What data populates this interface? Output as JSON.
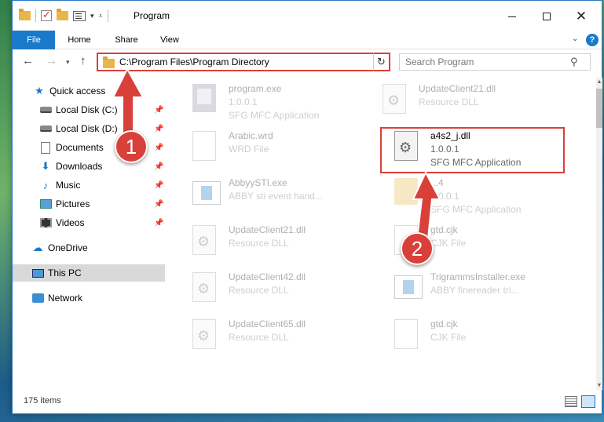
{
  "window": {
    "title": "Program"
  },
  "ribbon": {
    "tabs": [
      {
        "label": "File"
      },
      {
        "label": "Home"
      },
      {
        "label": "Share"
      },
      {
        "label": "View"
      }
    ]
  },
  "nav": {
    "address_path": "C:\\Program Files\\Program Directory",
    "search_placeholder": "Search Program"
  },
  "sidebar": {
    "items": [
      {
        "label": "Quick access"
      },
      {
        "label": "Local Disk (C:)"
      },
      {
        "label": "Local Disk (D:)"
      },
      {
        "label": "Documents"
      },
      {
        "label": "Downloads"
      },
      {
        "label": "Music"
      },
      {
        "label": "Pictures"
      },
      {
        "label": "Videos"
      },
      {
        "label": "OneDrive"
      },
      {
        "label": "This PC"
      },
      {
        "label": "Network"
      }
    ]
  },
  "files": [
    {
      "name": "program.exe",
      "line2": "1.0.0.1",
      "line3": "SFG MFC Application"
    },
    {
      "name": "UpdateClient21.dll",
      "line2": "Resource DLL",
      "line3": ""
    },
    {
      "name": "Arabic.wrd",
      "line2": "WRD File",
      "line3": ""
    },
    {
      "name": "a4s2_j.dll",
      "line2": "1.0.0.1",
      "line3": "SFG MFC Application"
    },
    {
      "name": "AbbyySTI.exe",
      "line2": "ABBY sti event hand...",
      "line3": ""
    },
    {
      "name": "...4",
      "line2": "1.0.0.1",
      "line3": "SFG MFC Application"
    },
    {
      "name": "UpdateClient21.dll",
      "line2": "Resource DLL",
      "line3": ""
    },
    {
      "name": "gtd.cjk",
      "line2": "CJK File",
      "line3": ""
    },
    {
      "name": "UpdateClient42.dll",
      "line2": "Resource DLL",
      "line3": ""
    },
    {
      "name": "TrigrammsInstaller.exe",
      "line2": "ABBY finereader tri...",
      "line3": ""
    },
    {
      "name": "UpdateClient65.dll",
      "line2": "Resource DLL",
      "line3": ""
    },
    {
      "name": "gtd.cjk",
      "line2": "CJK File",
      "line3": ""
    }
  ],
  "status": {
    "item_count": "175 items"
  },
  "annotations": {
    "badge1": "1",
    "badge2": "2",
    "color": "#d9403a"
  }
}
